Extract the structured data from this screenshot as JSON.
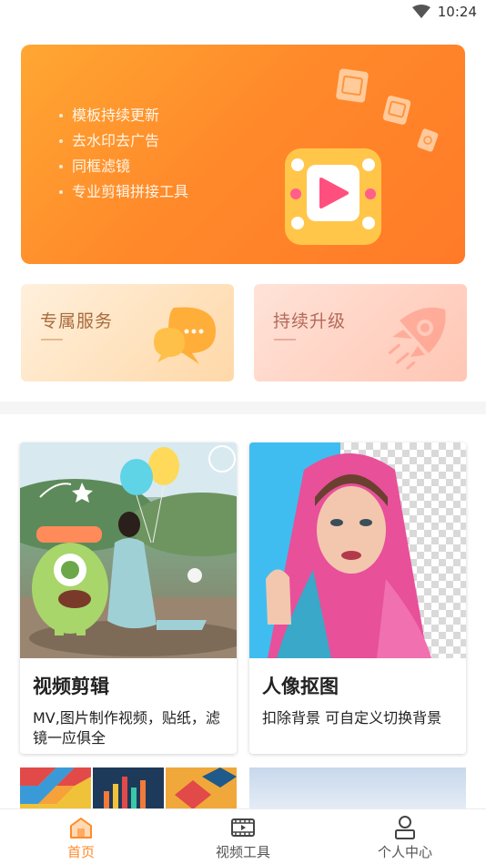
{
  "status_bar": {
    "time": "10:24"
  },
  "hero": {
    "bullets": [
      "模板持续更新",
      "去水印去广告",
      "同框滤镜",
      "专业剪辑拼接工具"
    ]
  },
  "features": [
    {
      "title": "专属服务"
    },
    {
      "title": "持续升级"
    }
  ],
  "tools": [
    {
      "title": "视频剪辑",
      "desc": "MV,图片制作视频，贴纸，滤镜一应俱全"
    },
    {
      "title": "人像抠图",
      "desc": "扣除背景 可自定义切换背景"
    }
  ],
  "bottom_nav": [
    {
      "label": "首页",
      "icon": "home-icon",
      "active": true
    },
    {
      "label": "视频工具",
      "icon": "video-tools-icon",
      "active": false
    },
    {
      "label": "个人中心",
      "icon": "profile-icon",
      "active": false
    }
  ],
  "colors": {
    "accent": "#ff8a2a",
    "hero_start": "#ffa733",
    "hero_end": "#ff7a28"
  }
}
